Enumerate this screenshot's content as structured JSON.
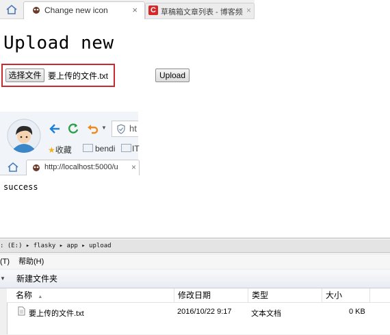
{
  "browser1": {
    "active_tab_title": "Change new icon",
    "other_tab_title": "草稿箱文章列表 - 博客频",
    "other_tab_icon_letter": "C",
    "close_glyph": "×"
  },
  "upload_page": {
    "heading": "Upload new",
    "choose_button": "选择文件",
    "selected_file": "要上传的文件.txt",
    "upload_button": "Upload"
  },
  "browser2": {
    "address_text": "ht",
    "bookmarks": [
      "收藏",
      "bendi",
      "IT"
    ],
    "tab_url": "http://localhost:5000/u",
    "close_glyph": "×",
    "page_text": "success"
  },
  "explorer": {
    "path": ": (E:) ▸ flasky ▸ app ▸ upload",
    "menu": [
      "(T)",
      "帮助(H)"
    ],
    "new_folder": "新建文件夹",
    "columns": [
      "名称",
      "修改日期",
      "类型",
      "大小"
    ],
    "sort_glyph": "▲",
    "files": [
      {
        "name": "要上传的文件.txt",
        "modified": "2016/10/22 9:17",
        "type": "文本文档",
        "size": "0 KB"
      }
    ]
  },
  "colors": {
    "accent_red": "#c8282e",
    "brand_blue": "#1e7fd6",
    "green": "#2aa14a"
  }
}
